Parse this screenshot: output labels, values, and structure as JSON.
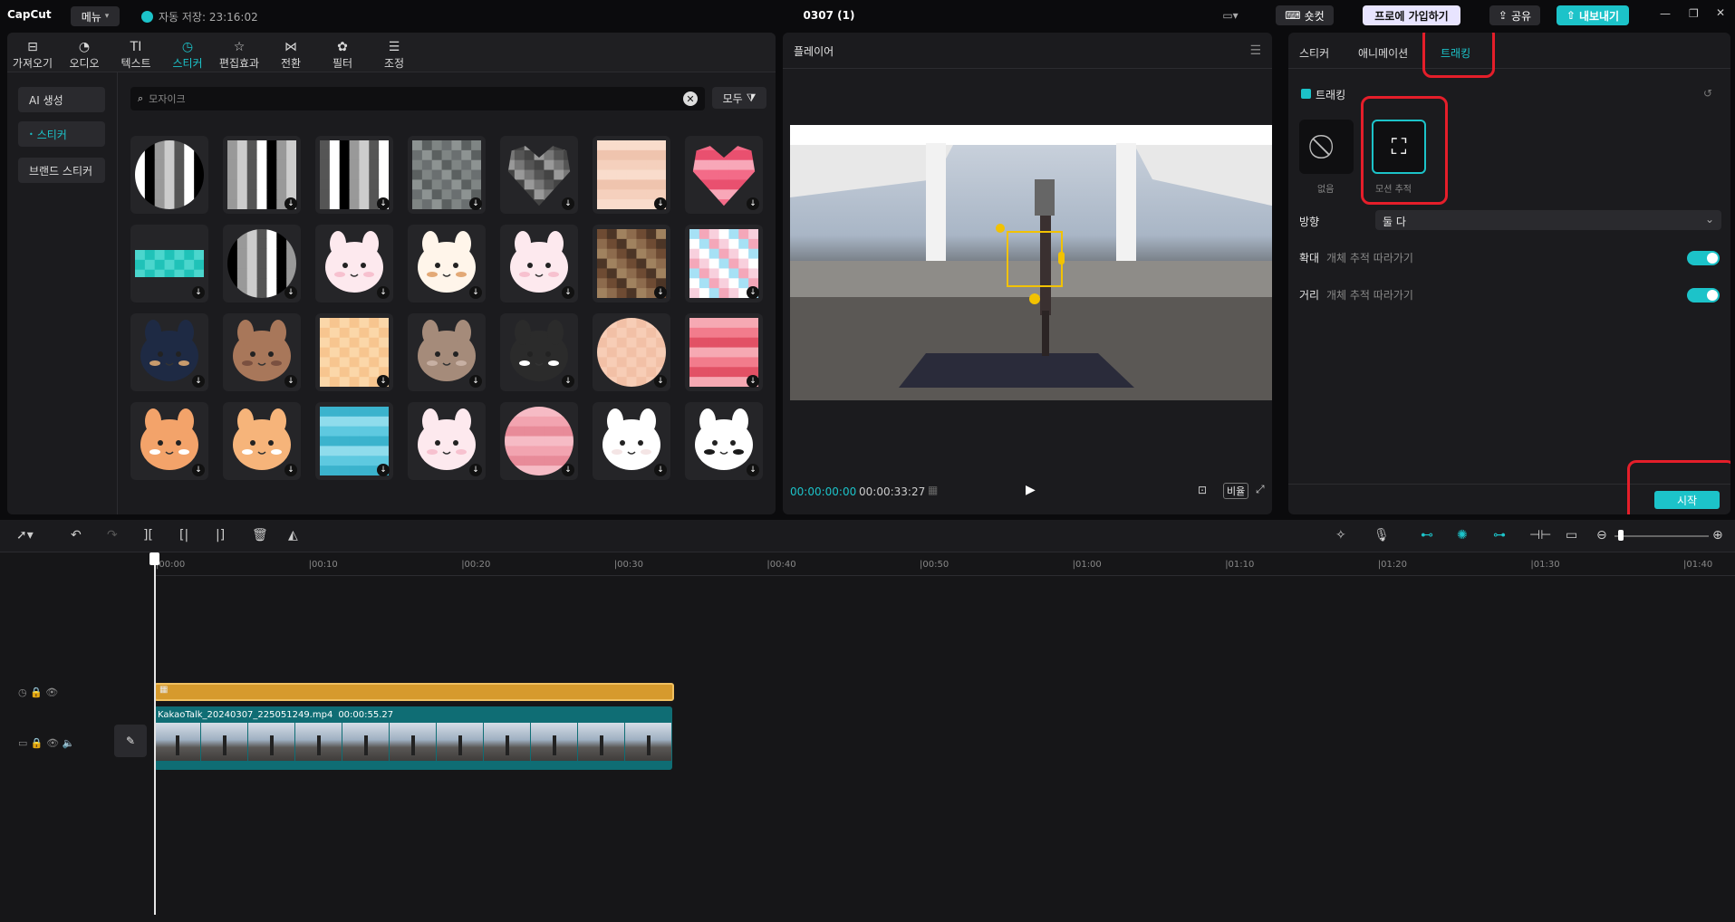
{
  "app": {
    "logo": "CapCut",
    "menu_label": "메뉴",
    "autosave": "자동 저장: 23:16:02",
    "project_title": "0307 (1)",
    "shortcuts_label": "숏컷",
    "pro_label": "프로에 가입하기",
    "share_label": "공유",
    "export_label": "내보내기"
  },
  "media_tabs": [
    {
      "label": "가져오기",
      "icon": "import-icon"
    },
    {
      "label": "오디오",
      "icon": "audio-icon"
    },
    {
      "label": "텍스트",
      "icon": "text-icon"
    },
    {
      "label": "스티커",
      "icon": "sticker-icon",
      "active": true
    },
    {
      "label": "편집효과",
      "icon": "effects-icon"
    },
    {
      "label": "전환",
      "icon": "transition-icon"
    },
    {
      "label": "필터",
      "icon": "filter-icon"
    },
    {
      "label": "조정",
      "icon": "adjust-icon"
    }
  ],
  "sticker_sidebar": [
    {
      "label": "AI 생성"
    },
    {
      "label": "스티커",
      "active": true
    },
    {
      "label": "브랜드 스티커"
    }
  ],
  "search": {
    "value": "모자이크"
  },
  "filter_label": "모두",
  "stickers": [
    "mosaic-circle",
    "mosaic-square",
    "mosaic-square",
    "mosaic-gray",
    "mosaic-heart-gray",
    "mosaic-skin",
    "mosaic-heart-pink",
    "tape-teal",
    "mosaic-circle",
    "bunny",
    "cat",
    "bunny",
    "mosaic-brown",
    "mosaic-pastel",
    "pearl-earring-girl",
    "bear",
    "mosaic-peach",
    "hedgehog",
    "penguin",
    "mosaic-skin-circle",
    "mosaic-red",
    "crying-tiger",
    "crying-dog",
    "mosaic-blue",
    "bunny",
    "mosaic-pink-circle",
    "sheep",
    "cow"
  ],
  "player": {
    "title": "플레이어",
    "time_current": "00:00:00:00",
    "time_total": "00:00:33:27",
    "ratio_label": "비율"
  },
  "inspector": {
    "tabs": [
      {
        "label": "스티커"
      },
      {
        "label": "애니메이션"
      },
      {
        "label": "트래킹",
        "active": true
      }
    ],
    "tracking_label": "트래킹",
    "option_none": "없음",
    "option_motion": "모션 추적",
    "direction_label": "방향",
    "direction_value": "둘 다",
    "scale_label": "확대",
    "scale_desc": "개체 추적 따라가기",
    "distance_label": "거리",
    "distance_desc": "개체 추적 따라가기",
    "start_label": "시작"
  },
  "timeline": {
    "ticks": [
      "00:00",
      "00:10",
      "00:20",
      "00:30",
      "00:40",
      "00:50",
      "01:00",
      "01:10",
      "01:20",
      "01:30",
      "01:40"
    ],
    "clip_name": "KakaoTalk_20240307_225051249.mp4",
    "clip_duration": "00:00:55.27"
  },
  "colors": {
    "accent": "#1cc3c9",
    "highlight": "#e51e2a",
    "sticker_track": "#d69a2d",
    "video_track": "#0f6d74"
  }
}
